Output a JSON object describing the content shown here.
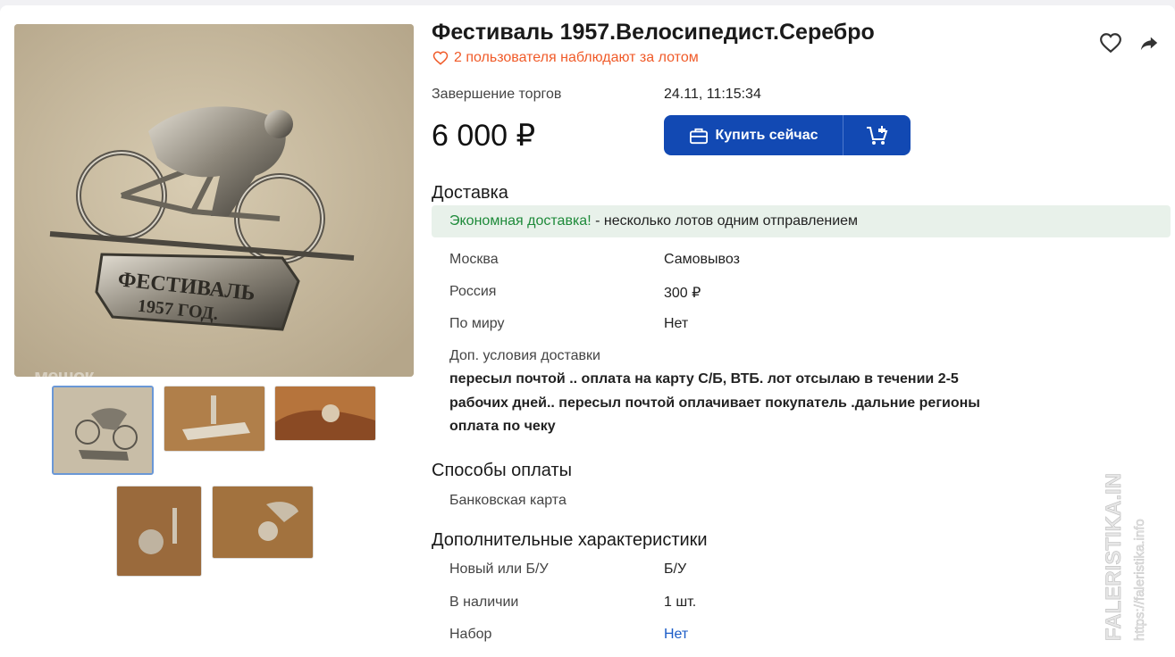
{
  "lot": {
    "title": "Фестиваль 1957.Велосипедист.Серебро",
    "watchers_text": "2 пользователя наблюдают за лотом",
    "end_label": "Завершение торгов",
    "end_value": "24.11, 11:15:34",
    "price": "6 000 ₽",
    "buy_now_label": "Купить сейчас",
    "photo_watermark": "мешок"
  },
  "icons": {
    "favorite": "heart-icon",
    "share": "share-icon",
    "watchers": "heart-outline-icon",
    "buy": "briefcase-icon",
    "cart": "cart-add-icon"
  },
  "colors": {
    "accent": "#1249b3",
    "watchers": "#f05a28",
    "economy_green": "#1e8a3a",
    "economy_bg": "#e8f1ea",
    "link": "#1b5cc7"
  },
  "delivery": {
    "heading": "Доставка",
    "economy_highlight": "Экономная доставка!",
    "economy_rest": " - несколько лотов одним отправлением",
    "rows": [
      {
        "label": "Москва",
        "value": "Самовывоз"
      },
      {
        "label": "Россия",
        "value": "300 ₽"
      },
      {
        "label": "По миру",
        "value": "Нет"
      }
    ],
    "extra_label": "Доп. условия доставки",
    "extra_text": "пересыл почтой .. оплата на карту С/Б, ВТБ. лот отсылаю в течении 2-5 рабочих дней.. пересыл почтой оплачивает покупатель .дальние регионы оплата по чеку"
  },
  "payment": {
    "heading": "Способы оплаты",
    "method": "Банковская карта"
  },
  "characteristics": {
    "heading": "Дополнительные характеристики",
    "rows": [
      {
        "label": "Новый или Б/У",
        "value": "Б/У"
      },
      {
        "label": "В наличии",
        "value": "1 шт."
      },
      {
        "label": "Набор",
        "value": "Нет"
      }
    ]
  },
  "side_watermark": {
    "line1": "FALERISTIKA.INFO",
    "line2": "https://faleristika.info"
  }
}
